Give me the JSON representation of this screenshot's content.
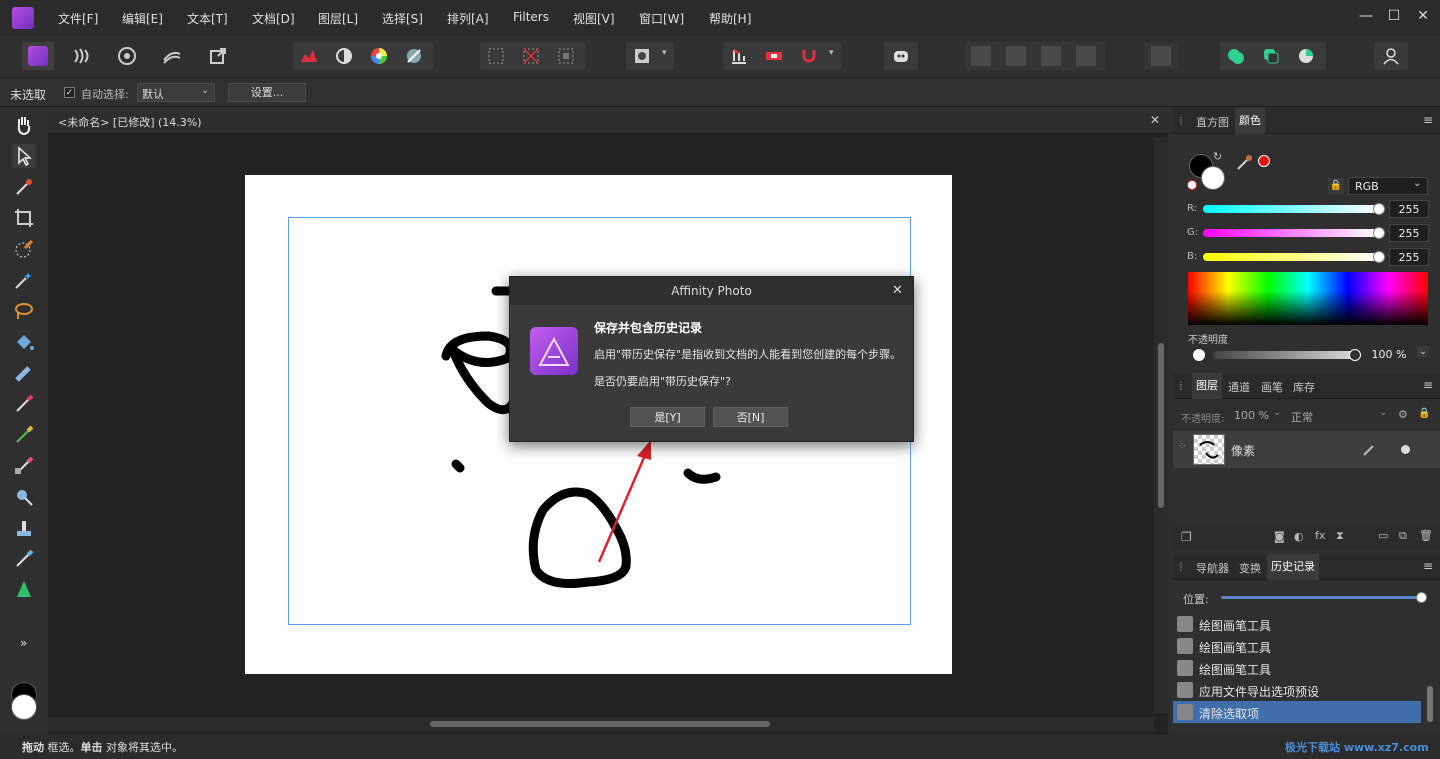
{
  "app": {
    "name": "Affinity Photo"
  },
  "menu": [
    "文件[F]",
    "编辑[E]",
    "文本[T]",
    "文档[D]",
    "图层[L]",
    "选择[S]",
    "排列[A]",
    "Filters",
    "视图[V]",
    "窗口[W]",
    "帮助[H]"
  ],
  "window_controls": {
    "minimize": "—",
    "maximize": "☐",
    "close": "✕"
  },
  "context_bar": {
    "selection_label": "未选取",
    "auto_select_label": "自动选择:",
    "auto_select_value": "默认",
    "settings_button": "设置..."
  },
  "document": {
    "tab_title": "<未命名> [已修改] (14.3%)",
    "close": "✕"
  },
  "dialog": {
    "title": "Affinity Photo",
    "heading": "保存并包含历史记录",
    "message1": "启用\"带历史保存\"是指收到文档的人能看到您创建的每个步骤。",
    "message2": "是否仍要启用\"带历史保存\"?",
    "yes_button": "是[Y]",
    "no_button": "否[N]",
    "close": "✕"
  },
  "panel_top": {
    "tabs": [
      "直方图",
      "颜色"
    ],
    "active_tab": "颜色",
    "color_model": "RGB",
    "channels": [
      {
        "label": "R:",
        "value": "255",
        "color": "#00ffff"
      },
      {
        "label": "G:",
        "value": "255",
        "color": "#ff00ff"
      },
      {
        "label": "B:",
        "value": "255",
        "color": "#ffff00"
      }
    ],
    "opacity_label": "不透明度",
    "opacity_value": "100 %"
  },
  "panel_layers": {
    "tabs": [
      "图层",
      "通道",
      "画笔",
      "库存"
    ],
    "active_tab": "图层",
    "opacity_label": "不透明度:",
    "opacity_value": "100 %",
    "blend_mode": "正常",
    "layer_name": "像素"
  },
  "panel_history": {
    "tabs": [
      "导航器",
      "变换",
      "历史记录"
    ],
    "active_tab": "历史记录",
    "position_label": "位置:",
    "position_fraction": 1.0,
    "items": [
      "绘图画笔工具",
      "绘图画笔工具",
      "绘图画笔工具",
      "应用文件导出选项预设",
      "清除选取项"
    ],
    "selected_index": 4
  },
  "status": {
    "bold1": "拖动",
    "text1": " 框选。",
    "bold2": "单击",
    "text2": " 对象将其选中。"
  },
  "watermark": "极光下载站 www.xz7.com",
  "colors": {
    "accent": "#3f6fa8",
    "brand": "#a246d6",
    "arrow": "#e0202a"
  }
}
